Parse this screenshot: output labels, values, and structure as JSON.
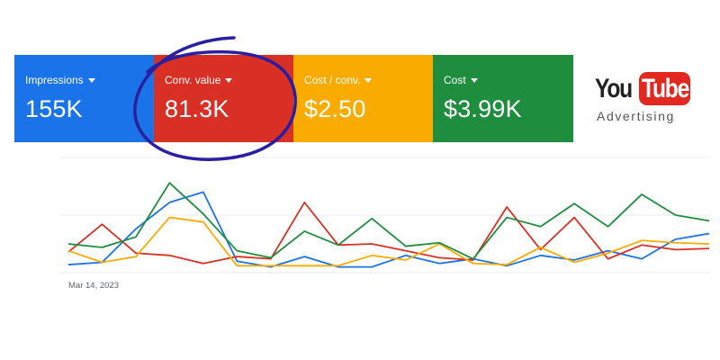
{
  "metrics": [
    {
      "label": "Impressions",
      "value": "155K",
      "color": "#1a73e8"
    },
    {
      "label": "Conv. value",
      "value": "81.3K",
      "color": "#d93025"
    },
    {
      "label": "Cost / conv.",
      "value": "$2.50",
      "color": "#f9ab00"
    },
    {
      "label": "Cost",
      "value": "$3.99K",
      "color": "#1e8e3e"
    }
  ],
  "logo": {
    "part1": "You",
    "part2": "Tube",
    "subtitle": "Advertising"
  },
  "icons": {
    "dropdown": "caret-down-icon",
    "highlight": "hand-drawn-circle"
  },
  "highlight_color": "#2a1fa0",
  "chart_data": {
    "type": "line",
    "x_start_label": "Mar 14, 2023",
    "points": 20,
    "ylim": [
      0,
      100
    ],
    "grid": true,
    "series": [
      {
        "color": "#1a73e8",
        "values": [
          7,
          9,
          38,
          61,
          70,
          10,
          5,
          14,
          5,
          5,
          15,
          8,
          12,
          6,
          15,
          11,
          19,
          12,
          29,
          34
        ]
      },
      {
        "color": "#d93025",
        "values": [
          18,
          42,
          17,
          15,
          8,
          14,
          12,
          61,
          24,
          25,
          19,
          13,
          11,
          57,
          20,
          48,
          12,
          24,
          20,
          21
        ]
      },
      {
        "color": "#f9ab00",
        "values": [
          19,
          9,
          14,
          48,
          44,
          6,
          6,
          6,
          6,
          15,
          11,
          25,
          8,
          7,
          22,
          9,
          17,
          28,
          26,
          25
        ]
      },
      {
        "color": "#1e8e3e",
        "values": [
          25,
          22,
          31,
          78,
          51,
          19,
          13,
          36,
          24,
          47,
          23,
          26,
          12,
          48,
          40,
          60,
          40,
          68,
          50,
          45
        ]
      }
    ]
  }
}
